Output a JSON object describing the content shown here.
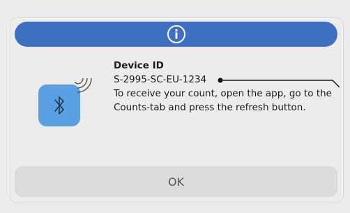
{
  "dialog": {
    "header_icon": "info-icon",
    "device_icon": "bluetooth-icon",
    "device_label": "Device ID",
    "device_id": "S-2995-SC-EU-1234",
    "message": "To receive your count, open the app, go to the Counts-tab and press the refresh button.",
    "ok_label": "OK"
  },
  "colors": {
    "header": "#3e6fc0",
    "bluetooth_tile": "#5a9fe0",
    "background": "#ececec",
    "button": "#dcdcdc"
  }
}
